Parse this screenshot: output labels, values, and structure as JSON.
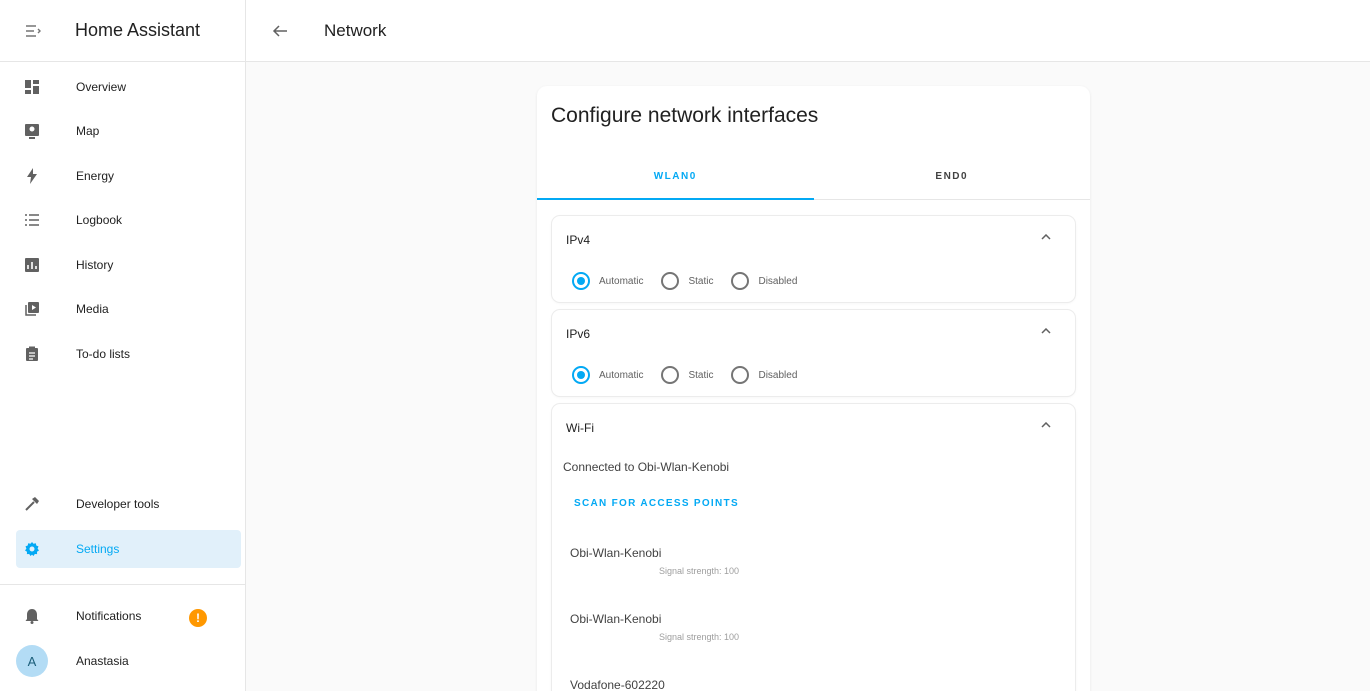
{
  "app": {
    "title": "Home Assistant"
  },
  "topbar": {
    "title": "Network"
  },
  "sidebar": {
    "items": [
      {
        "label": "Overview"
      },
      {
        "label": "Map"
      },
      {
        "label": "Energy"
      },
      {
        "label": "Logbook"
      },
      {
        "label": "History"
      },
      {
        "label": "Media"
      },
      {
        "label": "To-do lists"
      }
    ],
    "developer_tools": "Developer tools",
    "settings": "Settings",
    "notifications": "Notifications",
    "notifications_badge": "!",
    "user_initial": "A",
    "user_name": "Anastasia"
  },
  "card": {
    "title": "Configure network interfaces",
    "tabs": [
      {
        "label": "WLAN0"
      },
      {
        "label": "END0"
      }
    ],
    "ipv4": {
      "title": "IPv4",
      "options": [
        {
          "label": "Automatic"
        },
        {
          "label": "Static"
        },
        {
          "label": "Disabled"
        }
      ],
      "selected": "Automatic"
    },
    "ipv6": {
      "title": "IPv6",
      "options": [
        {
          "label": "Automatic"
        },
        {
          "label": "Static"
        },
        {
          "label": "Disabled"
        }
      ],
      "selected": "Automatic"
    },
    "wifi": {
      "title": "Wi-Fi",
      "status": "Connected to Obi-Wlan-Kenobi",
      "scan_label": "SCAN FOR ACCESS POINTS",
      "access_points": [
        {
          "name": "Obi-Wlan-Kenobi",
          "signal": "Signal strength: 100"
        },
        {
          "name": "Obi-Wlan-Kenobi",
          "signal": "Signal strength: 100"
        },
        {
          "name": "Vodafone-602220",
          "signal": ""
        }
      ]
    }
  },
  "colors": {
    "accent": "#03a9f4",
    "badge": "#ff9800",
    "active_bg": "#e1f0fa"
  }
}
